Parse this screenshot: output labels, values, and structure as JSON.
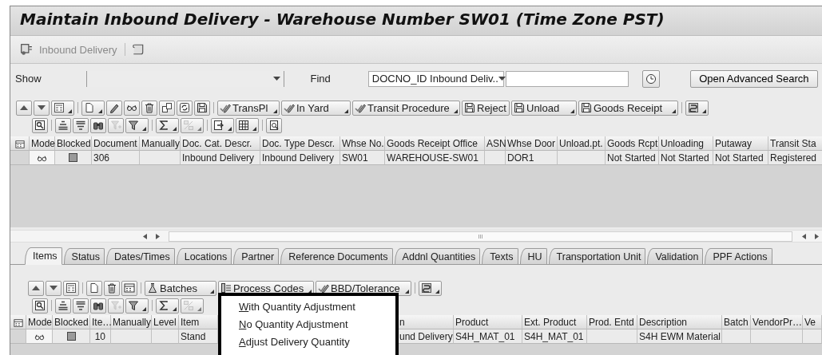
{
  "window": {
    "title": "Maintain Inbound Delivery - Warehouse Number SW01 (Time Zone PST)"
  },
  "app_toolbar": {
    "label": "Inbound Delivery"
  },
  "search": {
    "show_label": "Show",
    "find_label": "Find",
    "find_field": "DOCNO_ID Inbound Deliv..",
    "advanced_button": "Open Advanced Search"
  },
  "toolbar": {
    "buttons": [
      {
        "label": "TransPl",
        "kind": "transport",
        "dropdown": true
      },
      {
        "label": "In Yard",
        "kind": "transport",
        "dropdown": true
      },
      {
        "label": "Transit Procedure",
        "kind": "transport",
        "dropdown": true
      },
      {
        "label": "Reject",
        "kind": "save",
        "dropdown": false
      },
      {
        "label": "Unload",
        "kind": "save",
        "dropdown": true
      },
      {
        "label": "Goods Receipt",
        "kind": "save",
        "dropdown": true
      }
    ]
  },
  "delivery_table": {
    "columns": [
      {
        "label": "Mode",
        "kind": "mode"
      },
      {
        "label": "Blocked",
        "kind": "checkbox",
        "checked": false
      },
      {
        "label": "Document",
        "kind": "text",
        "value": "306"
      },
      {
        "label": "Manually",
        "kind": "text"
      },
      {
        "label": "Doc. Cat. Descr.",
        "kind": "text",
        "value": "Inbound Delivery"
      },
      {
        "label": "Doc. Type Descr.",
        "kind": "text",
        "value": "Inbound Delivery"
      },
      {
        "label": "Whse No.",
        "kind": "text",
        "value": "SW01"
      },
      {
        "label": "Goods Receipt Office",
        "kind": "text",
        "value": "WAREHOUSE-SW01"
      },
      {
        "label": "ASN",
        "kind": "text"
      },
      {
        "label": "Whse Door",
        "kind": "text",
        "value": "DOR1"
      },
      {
        "label": "Unload.pt.",
        "kind": "text"
      },
      {
        "label": "Goods Rcpt",
        "kind": "text",
        "value": "Not Started"
      },
      {
        "label": "Unloading",
        "kind": "text",
        "value": "Not Started"
      },
      {
        "label": "Putaway",
        "kind": "text",
        "value": "Not Started"
      },
      {
        "label": "Transit Sta",
        "kind": "text",
        "value": "Registered"
      }
    ]
  },
  "tabs": [
    {
      "label": "Items",
      "selected": true
    },
    {
      "label": "Status",
      "selected": false
    },
    {
      "label": "Dates/Times",
      "selected": false
    },
    {
      "label": "Locations",
      "selected": false
    },
    {
      "label": "Partner",
      "selected": false
    },
    {
      "label": "Reference Documents",
      "selected": false
    },
    {
      "label": "Addnl Quantities",
      "selected": false
    },
    {
      "label": "Texts",
      "selected": false
    },
    {
      "label": "HU",
      "selected": false
    },
    {
      "label": "Transportation Unit",
      "selected": false
    },
    {
      "label": "Validation",
      "selected": false
    },
    {
      "label": "PPF Actions",
      "selected": false
    }
  ],
  "item_toolbar": {
    "buttons": [
      {
        "label": "Batches",
        "kind": "flask",
        "dropdown": true
      },
      {
        "label": "Process Codes",
        "kind": "list",
        "dropdown": true
      },
      {
        "label": "BBD/Tolerance",
        "kind": "transport",
        "dropdown": true
      }
    ]
  },
  "items_table": {
    "columns": [
      {
        "label": "Mode",
        "kind": "mode"
      },
      {
        "label": "Blocked",
        "kind": "checkbox",
        "checked": false
      },
      {
        "label": "Ite…",
        "kind": "number",
        "value": "10"
      },
      {
        "label": "Manually",
        "kind": "text"
      },
      {
        "label": "Level",
        "kind": "text"
      },
      {
        "label": "Item",
        "kind": "text",
        "value": "Stand"
      },
      {
        "label": "n",
        "kind": "text",
        "value": "und Delivery"
      },
      {
        "label": "Product",
        "kind": "text",
        "value": "S4H_MAT_01"
      },
      {
        "label": "Ext. Product",
        "kind": "text",
        "value": "S4H_MAT_01"
      },
      {
        "label": "Prod. Entd",
        "kind": "text"
      },
      {
        "label": "Description",
        "kind": "text",
        "value": "S4H EWM Material"
      },
      {
        "label": "Batch",
        "kind": "text"
      },
      {
        "label": "VendorPr…",
        "kind": "text"
      },
      {
        "label": "Ve",
        "kind": "text"
      }
    ]
  },
  "context_menu": {
    "items": [
      "With Quantity Adjustment",
      "No Quantity Adjustment",
      "Adjust Delivery Quantity"
    ]
  }
}
